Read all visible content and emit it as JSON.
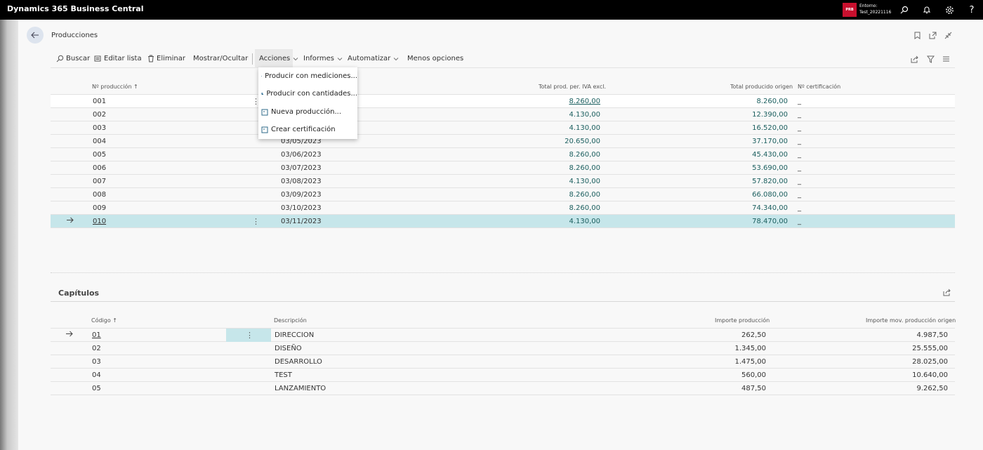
{
  "topbar": {
    "app_title": "Dynamics 365 Business Central",
    "env_badge": "PRB",
    "env_label": "Entorno:",
    "env_name": "Test_20221116"
  },
  "page": {
    "title": "Producciones"
  },
  "actions": {
    "search": "Buscar",
    "edit_list": "Editar lista",
    "delete": "Eliminar",
    "show_hide": "Mostrar/Ocultar",
    "acciones": "Acciones",
    "informes": "Informes",
    "automatizar": "Automatizar",
    "fewer_options": "Menos opciones"
  },
  "dropdown": {
    "items": [
      {
        "label": "Producir con mediciones...",
        "icon": "production-icon"
      },
      {
        "label": "Producir con cantidades...",
        "icon": "production-icon"
      },
      {
        "label": "Nueva producción...",
        "icon": "document-icon"
      },
      {
        "label": "Crear certificación",
        "icon": "document-icon"
      }
    ]
  },
  "productions": {
    "headers": {
      "number": "Nº producción ↑",
      "total_prod": "Total prod. per. IVA excl.",
      "total_origin": "Total producido origen",
      "certification": "Nº certificación"
    },
    "rows": [
      {
        "number": "001",
        "date": "",
        "total_prod": "8.260,00",
        "total_origin": "8.260,00",
        "cert": "_"
      },
      {
        "number": "002",
        "date": "",
        "total_prod": "4.130,00",
        "total_origin": "12.390,00",
        "cert": "_"
      },
      {
        "number": "003",
        "date": "",
        "total_prod": "4.130,00",
        "total_origin": "16.520,00",
        "cert": "_"
      },
      {
        "number": "004",
        "date": "03/05/2023",
        "total_prod": "20.650,00",
        "total_origin": "37.170,00",
        "cert": "_"
      },
      {
        "number": "005",
        "date": "03/06/2023",
        "total_prod": "8.260,00",
        "total_origin": "45.430,00",
        "cert": "_"
      },
      {
        "number": "006",
        "date": "03/07/2023",
        "total_prod": "8.260,00",
        "total_origin": "53.690,00",
        "cert": "_"
      },
      {
        "number": "007",
        "date": "03/08/2023",
        "total_prod": "4.130,00",
        "total_origin": "57.820,00",
        "cert": "_"
      },
      {
        "number": "008",
        "date": "03/09/2023",
        "total_prod": "8.260,00",
        "total_origin": "66.080,00",
        "cert": "_"
      },
      {
        "number": "009",
        "date": "03/10/2023",
        "total_prod": "8.260,00",
        "total_origin": "74.340,00",
        "cert": "_"
      },
      {
        "number": "010",
        "date": "03/11/2023",
        "total_prod": "4.130,00",
        "total_origin": "78.470,00",
        "cert": "_"
      }
    ]
  },
  "chapters": {
    "title": "Capítulos",
    "headers": {
      "code": "Código ↑",
      "description": "Descripción",
      "amount": "Importe producción",
      "amount_origin": "Importe mov. producción origen"
    },
    "rows": [
      {
        "code": "01",
        "description": "DIRECCION",
        "amount": "262,50",
        "amount_origin": "4.987,50"
      },
      {
        "code": "02",
        "description": "DISEÑO",
        "amount": "1.345,00",
        "amount_origin": "25.555,00"
      },
      {
        "code": "03",
        "description": "DESARROLLO",
        "amount": "1.475,00",
        "amount_origin": "28.025,00"
      },
      {
        "code": "04",
        "description": "TEST",
        "amount": "560,00",
        "amount_origin": "10.640,00"
      },
      {
        "code": "05",
        "description": "LANZAMIENTO",
        "amount": "487,50",
        "amount_origin": "9.262,50"
      }
    ]
  }
}
